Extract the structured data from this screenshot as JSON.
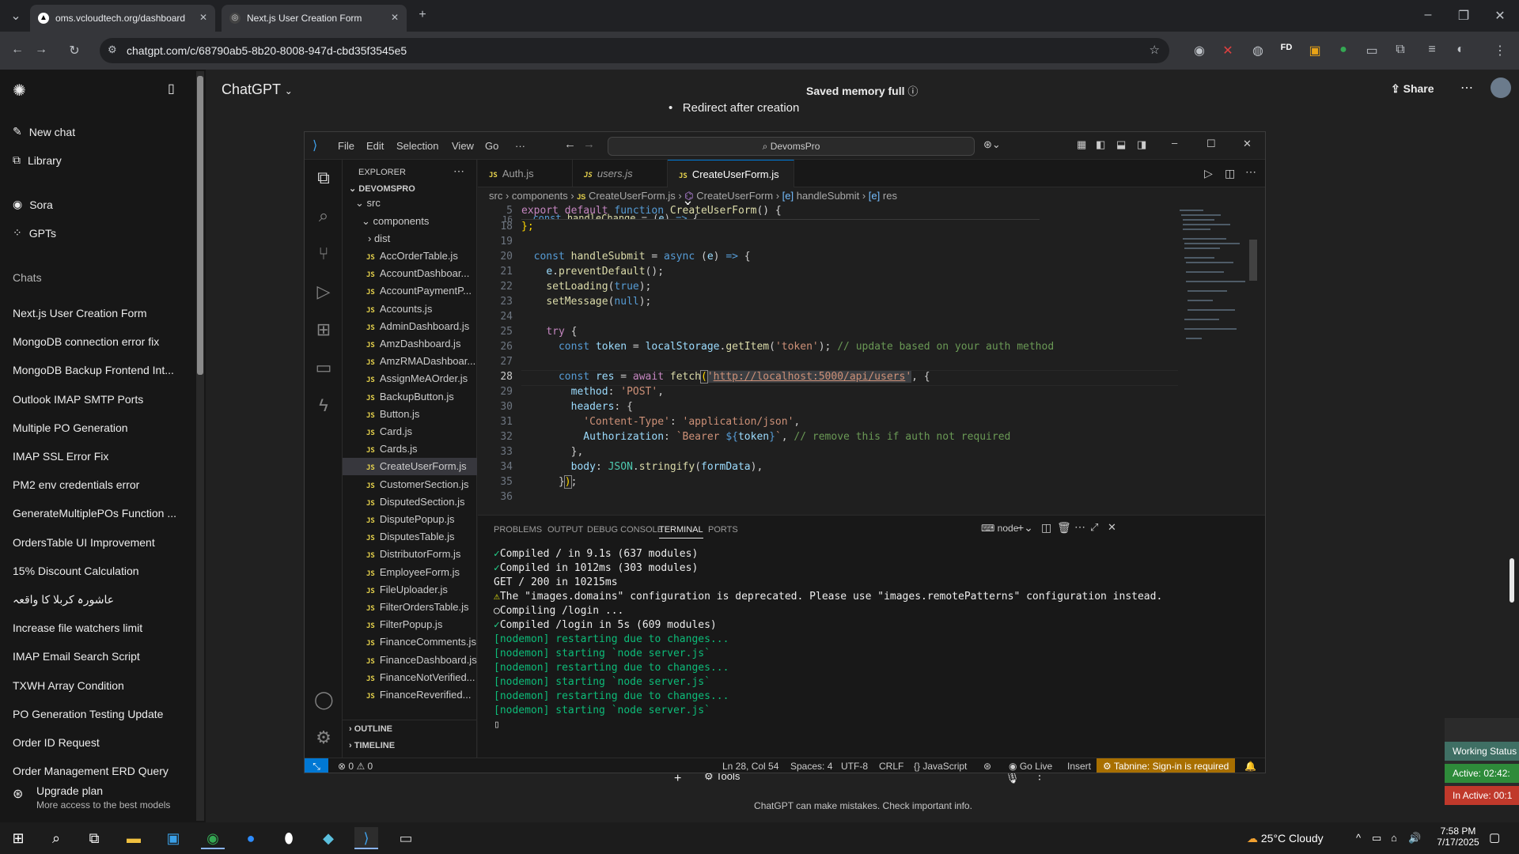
{
  "browser": {
    "tabs": [
      {
        "title": "oms.vcloudtech.org/dashboard"
      },
      {
        "title": "Next.js User Creation Form"
      }
    ],
    "url": "chatgpt.com/c/68790ab5-8b20-8008-947d-cbd35f3545e5"
  },
  "chatgpt": {
    "brand": "ChatGPT",
    "memory_status": "Saved memory full",
    "share_label": "Share",
    "nav": {
      "new_chat": "New chat",
      "library": "Library",
      "sora": "Sora",
      "gpts": "GPTs"
    },
    "chats_heading": "Chats",
    "chats": [
      "Next.js User Creation Form",
      "MongoDB connection error fix",
      "MongoDB Backup Frontend Int...",
      "Outlook IMAP SMTP Ports",
      "Multiple PO Generation",
      "IMAP SSL Error Fix",
      "PM2 env credentials error",
      "GenerateMultiplePOs Function ...",
      "OrdersTable UI Improvement",
      "15% Discount Calculation",
      "عاشورہ کربلا کا واقعہ",
      "Increase file watchers limit",
      "IMAP Email Search Script",
      "TXWH Array Condition",
      "PO Generation Testing Update",
      "Order ID Request",
      "Order Management ERD Query"
    ],
    "upgrade": {
      "title": "Upgrade plan",
      "subtitle": "More access to the best models"
    },
    "behind_text": "Redirect after creation",
    "tools_label": "Tools",
    "disclaimer": "ChatGPT can make mistakes. Check important info."
  },
  "vscode": {
    "menu": [
      "File",
      "Edit",
      "Selection",
      "View",
      "Go",
      "···"
    ],
    "search": "DevomsPro",
    "explorer": {
      "title": "EXPLORER",
      "root": "DEVOMSPRO",
      "folders": [
        "src",
        "components",
        "dist"
      ],
      "files": [
        "AccOrderTable.js",
        "AccountDashboar...",
        "AccountPaymentP...",
        "Accounts.js",
        "AdminDashboard.js",
        "AmzDashboard.js",
        "AmzRMADashboar...",
        "AssignMeAOrder.js",
        "BackupButton.js",
        "Button.js",
        "Card.js",
        "Cards.js",
        "CreateUserForm.js",
        "CustomerSection.js",
        "DisputedSection.js",
        "DisputePopup.js",
        "DisputesTable.js",
        "DistributorForm.js",
        "EmployeeForm.js",
        "FileUploader.js",
        "FilterOrdersTable.js",
        "FilterPopup.js",
        "FinanceComments.js",
        "FinanceDashboard.js",
        "FinanceNotVerified...",
        "FinanceReverified..."
      ],
      "selected": "CreateUserForm.js",
      "outline": "OUTLINE",
      "timeline": "TIMELINE"
    },
    "tabs": [
      "Auth.js",
      "users.js",
      "CreateUserForm.js"
    ],
    "breadcrumb": [
      "src",
      "components",
      "CreateUserForm.js",
      "CreateUserForm",
      "handleSubmit",
      "res"
    ],
    "sticky": {
      "ln": "5",
      "text": "export default function CreateUserForm() {"
    },
    "line_numbers": [
      "16",
      "18",
      "19",
      "20",
      "21",
      "22",
      "23",
      "24",
      "25",
      "26",
      "27",
      "28",
      "29",
      "30",
      "31",
      "32",
      "33",
      "34",
      "35",
      "36"
    ],
    "panel_tabs": [
      "PROBLEMS",
      "OUTPUT",
      "DEBUG CONSOLE",
      "TERMINAL",
      "PORTS"
    ],
    "terminal_shell": "node",
    "terminal": [
      "Compiled / in 9.1s (637 modules)",
      "Compiled in 1012ms (303 modules)",
      "GET / 200 in 10215ms",
      "The \"images.domains\" configuration is deprecated. Please use \"images.remotePatterns\" configuration instead.",
      "Compiling /login ...",
      "Compiled /login in 5s (609 modules)",
      "[nodemon] restarting due to changes...",
      "[nodemon] starting `node server.js`",
      "[nodemon] restarting due to changes...",
      "[nodemon] starting `node server.js`",
      "[nodemon] restarting due to changes...",
      "[nodemon] starting `node server.js`"
    ],
    "status": {
      "errors": "0",
      "warnings": "0",
      "position": "Ln 28, Col 54",
      "spaces": "Spaces: 4",
      "encoding": "UTF-8",
      "eol": "CRLF",
      "language": "JavaScript",
      "golive": "Go Live",
      "mode": "Insert",
      "tabnine": "Tabnine: Sign-in is required"
    }
  },
  "working_status": {
    "title": "Working Status",
    "active": "Active: 02:42:",
    "inactive": "In Active: 00:1"
  },
  "taskbar": {
    "weather": "25°C  Cloudy",
    "time": "7:58 PM",
    "date": "7/17/2025"
  },
  "colors": {
    "accent": "#0078d4",
    "tabnine": "#a86f00",
    "remote": "#0078d4"
  }
}
